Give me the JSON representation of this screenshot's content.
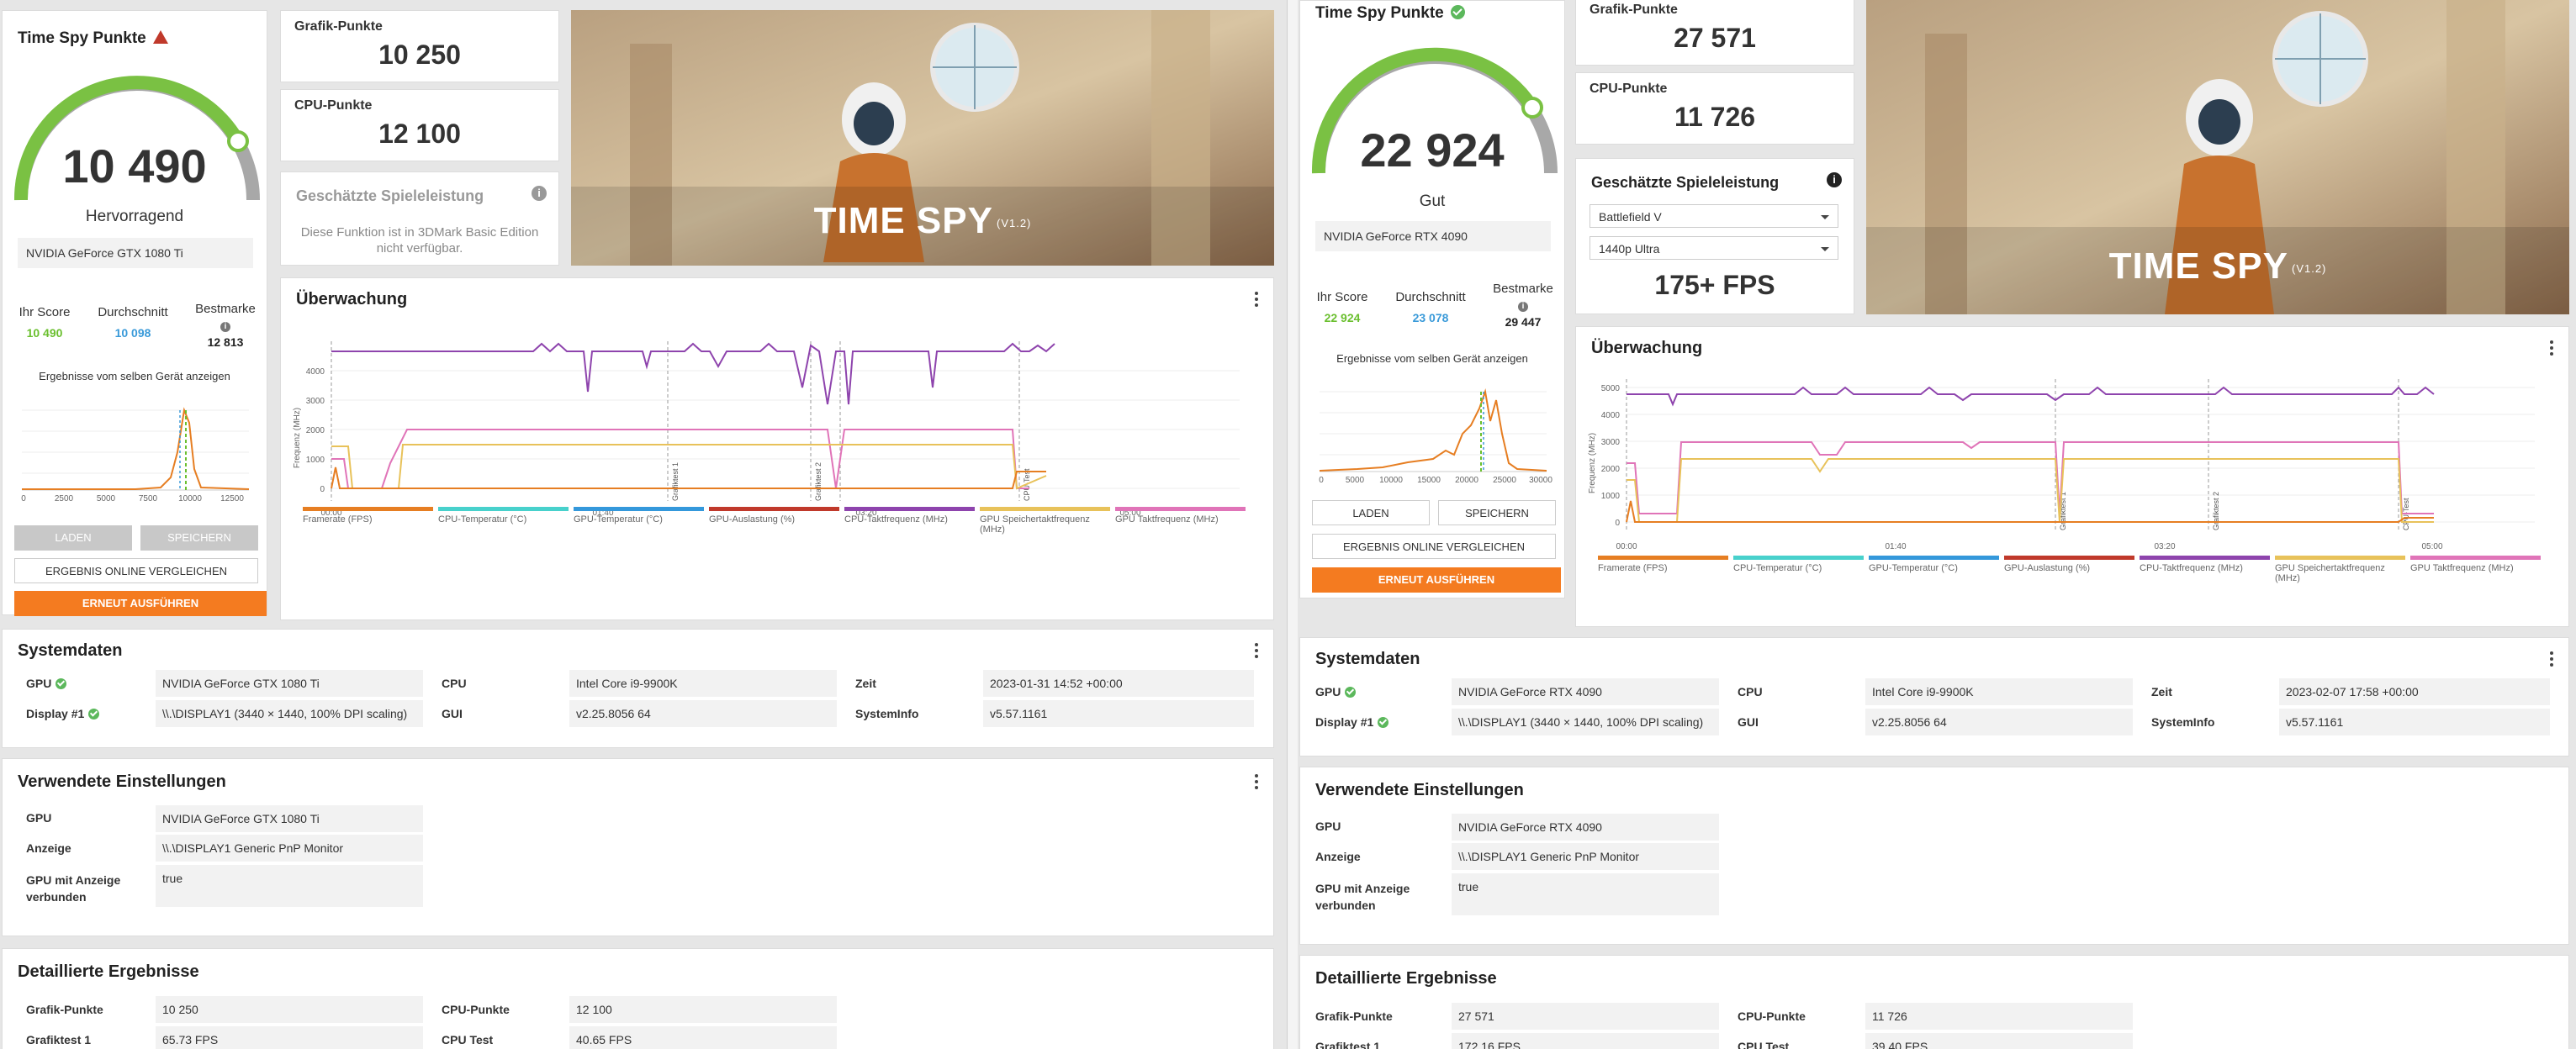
{
  "left": {
    "score": {
      "title": "Time Spy Punkte",
      "value": "10 490",
      "rating": "Hervorragend",
      "gpu": "NVIDIA GeForce GTX 1080 Ti",
      "gauge_fraction": 0.81
    },
    "stats": {
      "yours_label": "Ihr Score",
      "yours": "10 490",
      "avg_label": "Durchschnitt",
      "avg": "10 098",
      "best_label": "Bestmarke",
      "best": "12 813"
    },
    "same_device": "Ergebnisse vom selben Gerät anzeigen",
    "dist_ticks": [
      "0",
      "2500",
      "5000",
      "7500",
      "10000",
      "12500"
    ],
    "buttons": {
      "load": "LADEN",
      "save": "SPEICHERN",
      "compare": "ERGEBNIS ONLINE VERGLEICHEN",
      "rerun": "ERNEUT AUSFÜHREN"
    },
    "graphics": {
      "label": "Grafik-Punkte",
      "value": "10 250"
    },
    "cpu": {
      "label": "CPU-Punkte",
      "value": "12 100"
    },
    "game_est": {
      "label": "Geschätzte Spieleleistung",
      "text": "Diese Funktion ist in 3DMark Basic Edition nicht verfügbar."
    },
    "banner": {
      "name": "TIME SPY",
      "version": "(V1.2)"
    },
    "monitor": {
      "title": "Überwachung",
      "yticks": [
        "4000",
        "3000",
        "2000",
        "1000",
        "0"
      ],
      "xticks": [
        "00:00",
        "01:40",
        "03:20",
        "05:00"
      ],
      "ylabel": "Frequenz (MHz)",
      "markers": [
        "Grafiktest 1",
        "Grafiktest 2",
        "CPU-Test"
      ]
    },
    "system": {
      "title": "Systemdaten",
      "gpu_label": "GPU",
      "gpu": "NVIDIA GeForce GTX 1080 Ti",
      "display_label": "Display #1",
      "display": "\\\\.\\DISPLAY1 (3440 × 1440, 100% DPI scaling)",
      "cpu_label": "CPU",
      "cpu": "Intel Core i9-9900K",
      "gui_label": "GUI",
      "gui": "v2.25.8056 64",
      "time_label": "Zeit",
      "time": "2023-01-31 14:52 +00:00",
      "sysinfo_label": "SystemInfo",
      "sysinfo": "v5.57.1161"
    },
    "settings": {
      "title": "Verwendete Einstellungen",
      "gpu_label": "GPU",
      "gpu": "NVIDIA GeForce GTX 1080 Ti",
      "display_label": "Anzeige",
      "display": "\\\\.\\DISPLAY1 Generic PnP Monitor",
      "conn_label": "GPU mit Anzeige verbunden",
      "conn": "true"
    },
    "details": {
      "title": "Detaillierte Ergebnisse",
      "gp_label": "Grafik-Punkte",
      "gp": "10 250",
      "cp_label": "CPU-Punkte",
      "cp": "12 100",
      "gt1_label": "Grafiktest 1",
      "gt1": "65.73 FPS",
      "cput_label": "CPU Test",
      "cput": "40.65 FPS"
    }
  },
  "right": {
    "score": {
      "title": "Time Spy Punkte",
      "value": "22 924",
      "rating": "Gut",
      "gpu": "NVIDIA GeForce RTX 4090",
      "gauge_fraction": 0.78
    },
    "stats": {
      "yours_label": "Ihr Score",
      "yours": "22 924",
      "avg_label": "Durchschnitt",
      "avg": "23 078",
      "best_label": "Bestmarke",
      "best": "29 447"
    },
    "same_device": "Ergebnisse vom selben Gerät anzeigen",
    "dist_ticks": [
      "0",
      "5000",
      "10000",
      "15000",
      "20000",
      "25000",
      "30000"
    ],
    "buttons": {
      "load": "LADEN",
      "save": "SPEICHERN",
      "compare": "ERGEBNIS ONLINE VERGLEICHEN",
      "rerun": "ERNEUT AUSFÜHREN"
    },
    "graphics": {
      "label": "Grafik-Punkte",
      "value": "27 571"
    },
    "cpu": {
      "label": "CPU-Punkte",
      "value": "11 726"
    },
    "game_est": {
      "label": "Geschätzte Spieleleistung",
      "game": "Battlefield V",
      "res": "1440p Ultra",
      "fps": "175+ FPS"
    },
    "banner": {
      "name": "TIME SPY",
      "version": "(V1.2)"
    },
    "monitor": {
      "title": "Überwachung",
      "yticks": [
        "5000",
        "4000",
        "3000",
        "2000",
        "1000",
        "0"
      ],
      "xticks": [
        "00:00",
        "01:40",
        "03:20",
        "05:00"
      ],
      "ylabel": "Frequenz (MHz)",
      "markers": [
        "Grafiktest 1",
        "Grafiktest 2",
        "CPU-Test"
      ]
    },
    "system": {
      "title": "Systemdaten",
      "gpu_label": "GPU",
      "gpu": "NVIDIA GeForce RTX 4090",
      "display_label": "Display #1",
      "display": "\\\\.\\DISPLAY1 (3440 × 1440, 100% DPI scaling)",
      "cpu_label": "CPU",
      "cpu": "Intel Core i9-9900K",
      "gui_label": "GUI",
      "gui": "v2.25.8056 64",
      "time_label": "Zeit",
      "time": "2023-02-07 17:58 +00:00",
      "sysinfo_label": "SystemInfo",
      "sysinfo": "v5.57.1161"
    },
    "settings": {
      "title": "Verwendete Einstellungen",
      "gpu_label": "GPU",
      "gpu": "NVIDIA GeForce RTX 4090",
      "display_label": "Anzeige",
      "display": "\\\\.\\DISPLAY1 Generic PnP Monitor",
      "conn_label": "GPU mit Anzeige verbunden",
      "conn": "true"
    },
    "details": {
      "title": "Detaillierte Ergebnisse",
      "gp_label": "Grafik-Punkte",
      "gp": "27 571",
      "cp_label": "CPU-Punkte",
      "cp": "11 726",
      "gt1_label": "Grafiktest 1",
      "gt1": "172.16 FPS",
      "cput_label": "CPU Test",
      "cput": "39.40 FPS"
    }
  },
  "legend": [
    {
      "label": "Framerate (FPS)",
      "color": "#e67e22"
    },
    {
      "label": "CPU-Temperatur (°C)",
      "color": "#48d1cc"
    },
    {
      "label": "GPU-Temperatur (°C)",
      "color": "#3498db"
    },
    {
      "label": "GPU-Auslastung (%)",
      "color": "#c0392b"
    },
    {
      "label": "CPU-Taktfrequenz (MHz)",
      "color": "#8e44ad"
    },
    {
      "label": "GPU Speichertaktfrequenz (MHz)",
      "color": "#e8c25a"
    },
    {
      "label": "GPU Taktfrequenz (MHz)",
      "color": "#e074b8"
    }
  ],
  "colors": {
    "accent": "#f47b20",
    "gauge": "#7ac143",
    "your_score": "#6abf2e",
    "average": "#3a9ad9"
  }
}
